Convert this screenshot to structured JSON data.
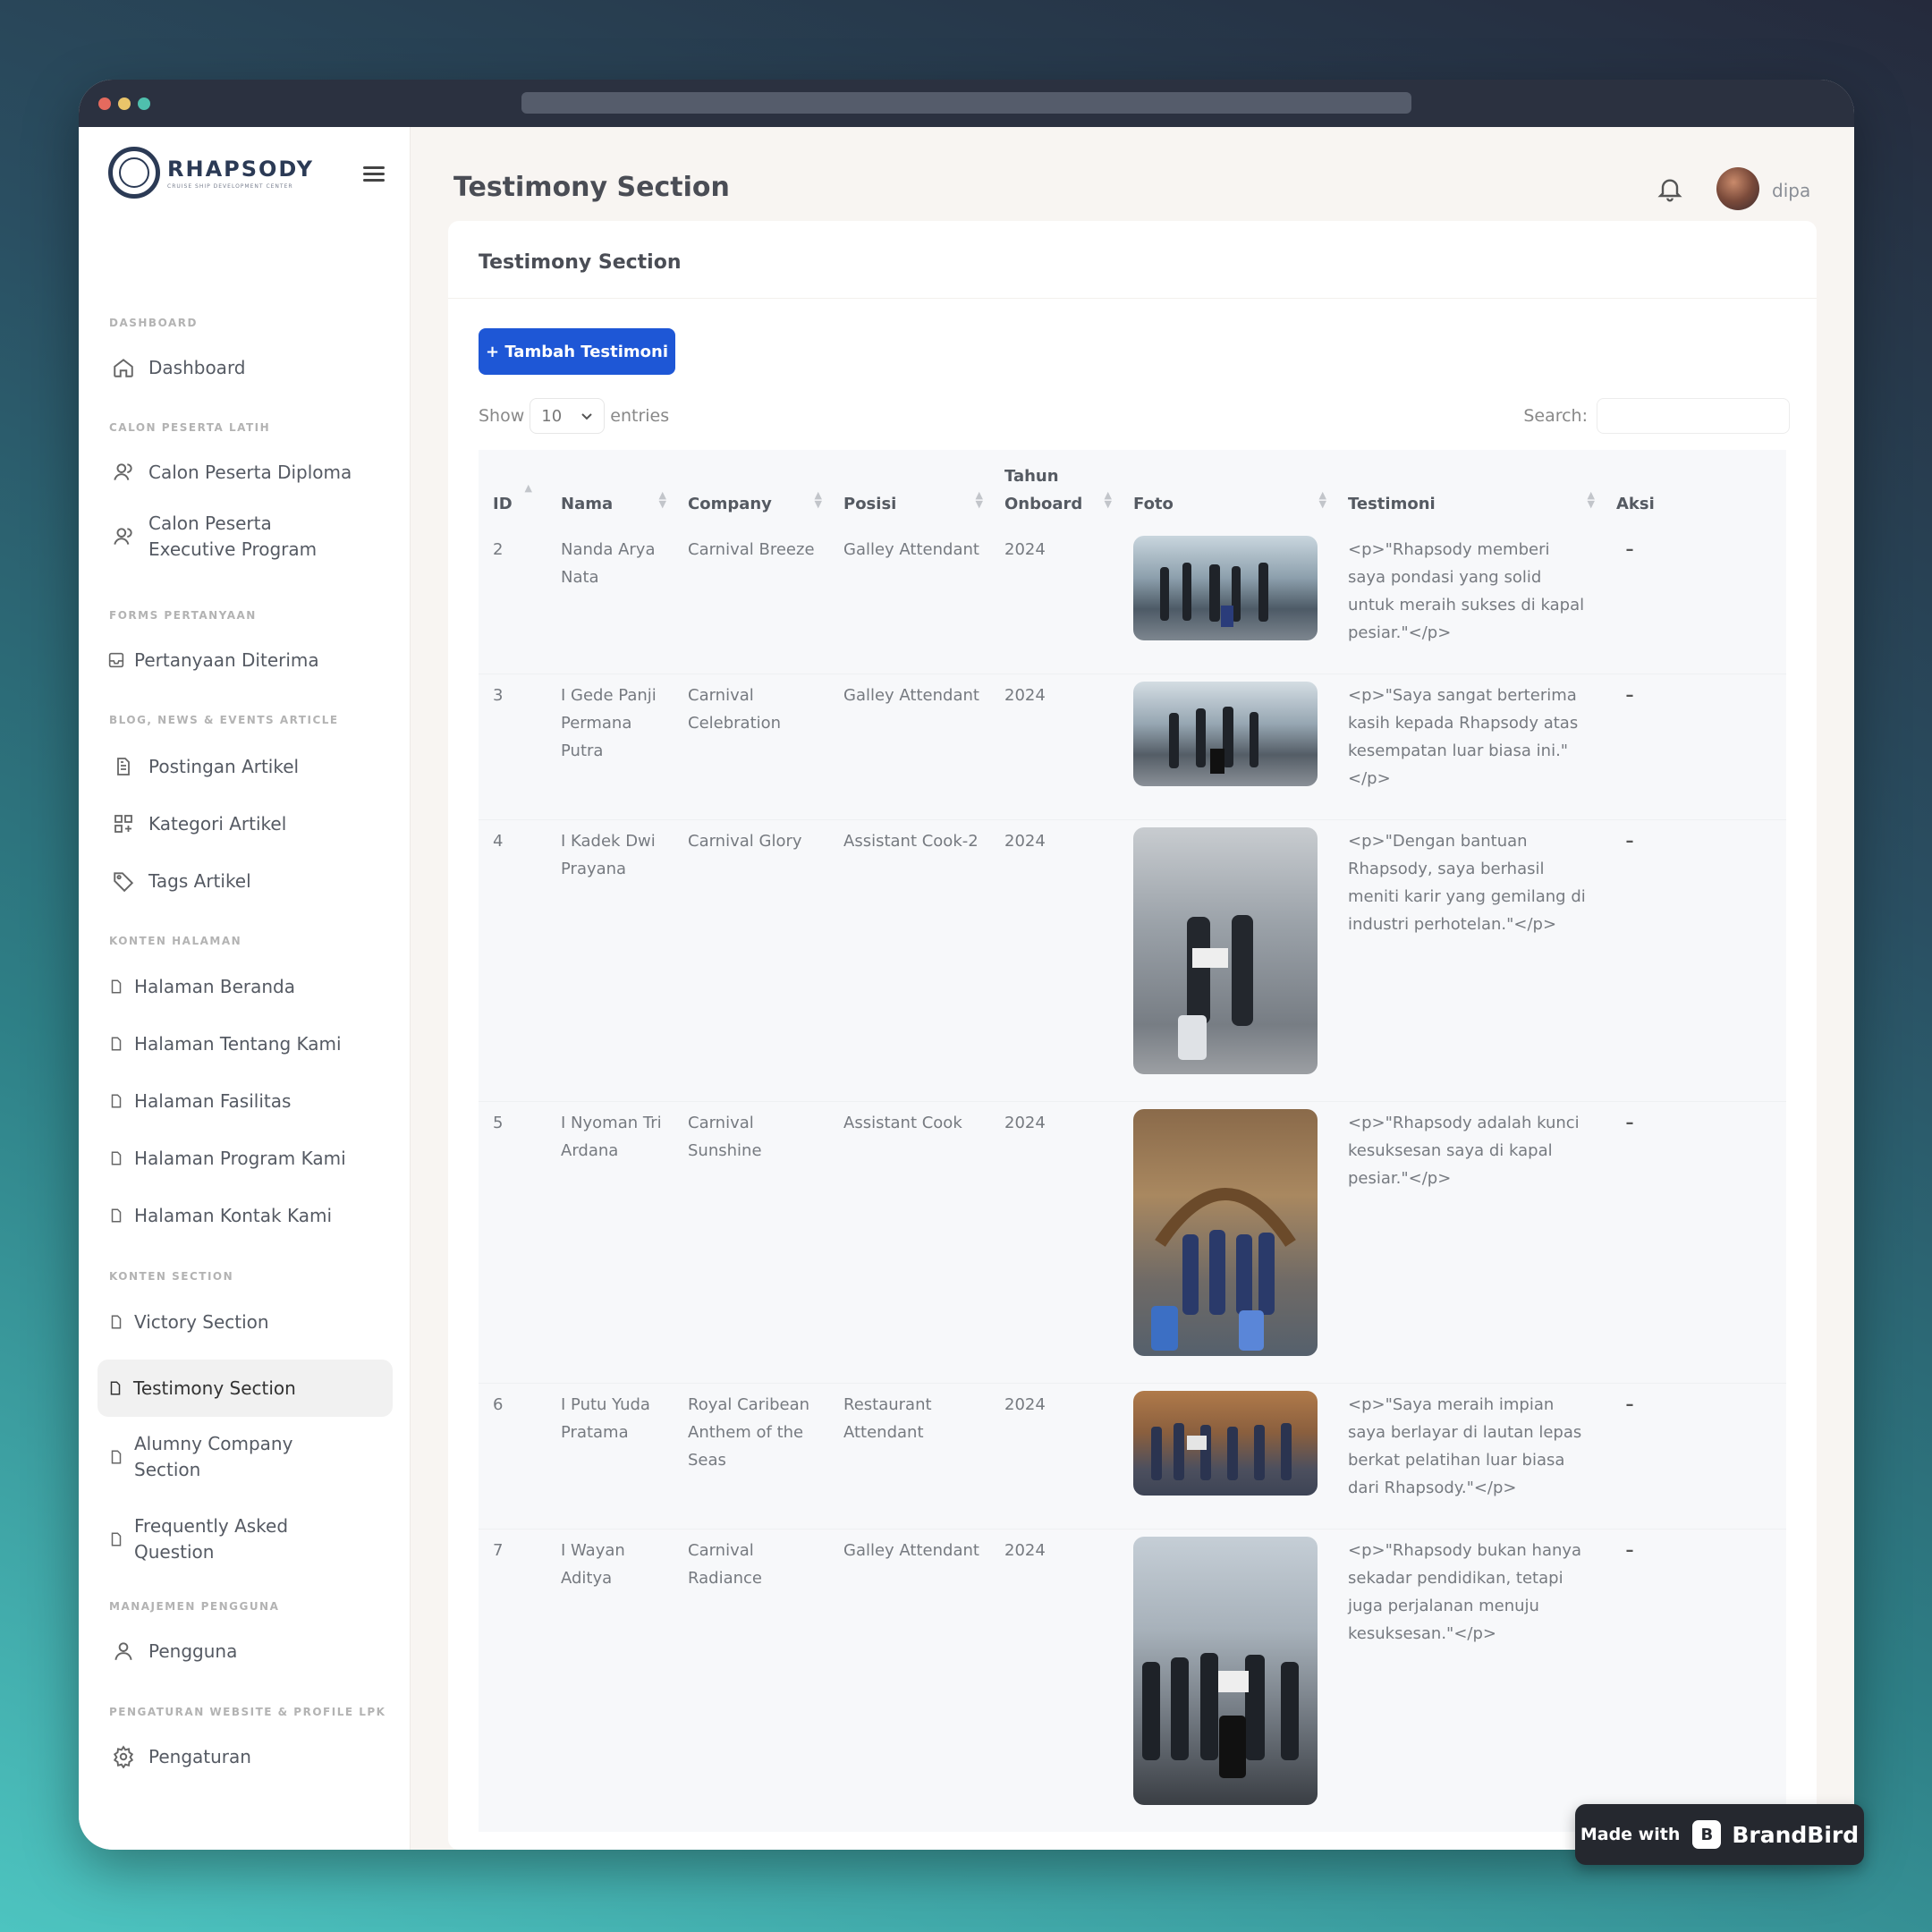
{
  "app": {
    "brand_name": "RHAPSODY",
    "brand_sub": "CRUISE SHIP DEVELOPMENT CENTER",
    "page_title": "Testimony Section",
    "user_name": "dipa"
  },
  "sidebar": {
    "sections": [
      {
        "label": "DASHBOARD"
      },
      {
        "label": "CALON PESERTA LATIH"
      },
      {
        "label": "FORMS PERTANYAAN"
      },
      {
        "label": "BLOG, NEWS & EVENTS ARTICLE"
      },
      {
        "label": "KONTEN HALAMAN"
      },
      {
        "label": "KONTEN SECTION"
      },
      {
        "label": "MANAJEMEN PENGGUNA"
      },
      {
        "label": "PENGATURAN WEBSITE & PROFILE LPK"
      }
    ],
    "items": [
      {
        "label": "Dashboard",
        "icon": "home-icon"
      },
      {
        "label": "Calon Peserta Diploma",
        "icon": "users-icon"
      },
      {
        "label": "Calon Peserta Executive Program",
        "icon": "users-icon"
      },
      {
        "label": "Pertanyaan Diterima",
        "icon": "inbox-icon"
      },
      {
        "label": "Postingan Artikel",
        "icon": "document-icon"
      },
      {
        "label": "Kategori Artikel",
        "icon": "grid-icon"
      },
      {
        "label": "Tags Artikel",
        "icon": "tag-icon"
      },
      {
        "label": "Halaman Beranda",
        "icon": "file-icon"
      },
      {
        "label": "Halaman Tentang Kami",
        "icon": "file-icon"
      },
      {
        "label": "Halaman Fasilitas",
        "icon": "file-icon"
      },
      {
        "label": "Halaman Program Kami",
        "icon": "file-icon"
      },
      {
        "label": "Halaman Kontak Kami",
        "icon": "file-icon"
      },
      {
        "label": "Victory Section",
        "icon": "file-icon"
      },
      {
        "label": "Testimony Section",
        "icon": "file-icon",
        "active": true
      },
      {
        "label": "Alumny Company Section",
        "icon": "file-icon"
      },
      {
        "label": "Frequently Asked Question",
        "icon": "file-icon"
      },
      {
        "label": "Pengguna",
        "icon": "user-icon"
      },
      {
        "label": "Pengaturan",
        "icon": "gear-icon"
      }
    ]
  },
  "card": {
    "title": "Testimony Section",
    "add_button": "+ Tambah Testimoni",
    "show_label": "Show",
    "show_value": "10",
    "entries_label": "entries",
    "search_label": "Search:",
    "search_value": ""
  },
  "table": {
    "headers": [
      "ID",
      "Nama",
      "Company",
      "Posisi",
      "Tahun Onboard",
      "Foto",
      "Testimoni",
      "Aksi"
    ],
    "rows": [
      {
        "id": "2",
        "nama": "Nanda Arya Nata",
        "company": "Carnival Breeze",
        "posisi": "Galley Attendant",
        "tahun": "2024",
        "testimoni": "<p>\"Rhapsody memberi saya pondasi yang solid untuk meraih sukses di kapal pesiar.\"</p>",
        "aksi": "–"
      },
      {
        "id": "3",
        "nama": "I Gede Panji Permana Putra",
        "company": "Carnival Celebration",
        "posisi": "Galley Attendant",
        "tahun": "2024",
        "testimoni": "<p>\"Saya sangat berterima kasih kepada Rhapsody atas kesempatan luar biasa ini.\"</p>",
        "aksi": "–"
      },
      {
        "id": "4",
        "nama": "I Kadek Dwi Prayana",
        "company": "Carnival Glory",
        "posisi": "Assistant Cook-2",
        "tahun": "2024",
        "testimoni": "<p>\"Dengan bantuan Rhapsody, saya berhasil meniti karir yang gemilang di industri perhotelan.\"</p>",
        "aksi": "–"
      },
      {
        "id": "5",
        "nama": "I Nyoman Tri Ardana",
        "company": "Carnival Sunshine",
        "posisi": "Assistant Cook",
        "tahun": "2024",
        "testimoni": "<p>\"Rhapsody adalah kunci kesuksesan saya di kapal pesiar.\"</p>",
        "aksi": "–"
      },
      {
        "id": "6",
        "nama": "I Putu Yuda Pratama",
        "company": "Royal Caribean Anthem of the Seas",
        "posisi": "Restaurant Attendant",
        "tahun": "2024",
        "testimoni": "<p>\"Saya meraih impian saya berlayar di lautan lepas berkat pelatihan luar biasa dari Rhapsody.\"</p>",
        "aksi": "–"
      },
      {
        "id": "7",
        "nama": "I Wayan Aditya",
        "company": "Carnival Radiance",
        "posisi": "Galley Attendant",
        "tahun": "2024",
        "testimoni": "<p>\"Rhapsody bukan hanya sekadar pendidikan, tetapi juga perjalanan menuju kesuksesan.\"</p>",
        "aksi": "–"
      }
    ]
  },
  "watermark": {
    "made_with": "Made with",
    "brand": "BrandBird"
  },
  "colors": {
    "primary_button": "#1e57d6",
    "sidebar_bg": "#ffffff",
    "content_bg": "#f8f5f2",
    "window_chrome": "#2b3140"
  }
}
